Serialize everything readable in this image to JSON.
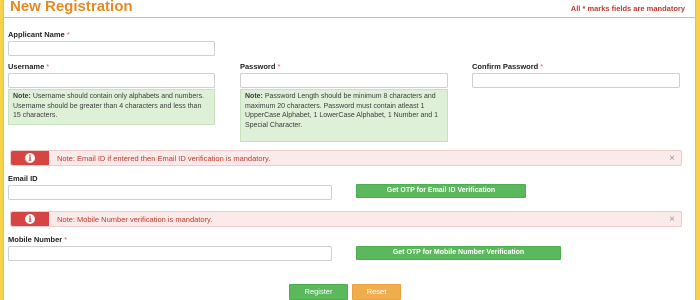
{
  "header": {
    "title": "New Registration",
    "mandatory_note": "All * marks fields are mandatory"
  },
  "form": {
    "applicant_name": {
      "label": "Applicant Name",
      "required": "*",
      "value": ""
    },
    "username": {
      "label": "Username",
      "required": "*",
      "value": ""
    },
    "password": {
      "label": "Password",
      "required": "*",
      "value": ""
    },
    "confirm_password": {
      "label": "Confirm Password",
      "required": "*",
      "value": ""
    },
    "username_note": {
      "prefix": "Note:",
      "text": "Username should contain only alphabets and numbers. Username should be greater than 4 characters and less than 15 characters."
    },
    "password_note": {
      "prefix": "Note:",
      "text": "Password Length should be minimum 8 characters and maximum 20 characters. Password must contain atleast 1 UpperCase Alphabet, 1 LowerCase Alphabet, 1 Number and 1 Special Character."
    },
    "email_alert": {
      "icon": "info-icon",
      "message": "Note: Email ID if entered then Email ID verification is mandatory.",
      "close": "×"
    },
    "email_id": {
      "label": "Email ID",
      "value": ""
    },
    "email_otp_button": "Get OTP for Email ID Verification",
    "mobile_alert": {
      "icon": "info-icon",
      "message": "Note: Mobile Number verification is mandatory.",
      "close": "×"
    },
    "mobile_number": {
      "label": "Mobile Number",
      "required": "*",
      "value": ""
    },
    "mobile_otp_button": "Get OTP for Mobile Number Verification",
    "register_button": "Register",
    "reset_button": "Reset"
  },
  "colors": {
    "title": "#e58a1f",
    "alert_badge": "#d64541",
    "note_background": "#dff0d8",
    "button_green": "#5cb85c",
    "button_orange": "#f0ad4e",
    "outer_border": "#f5d44a"
  }
}
